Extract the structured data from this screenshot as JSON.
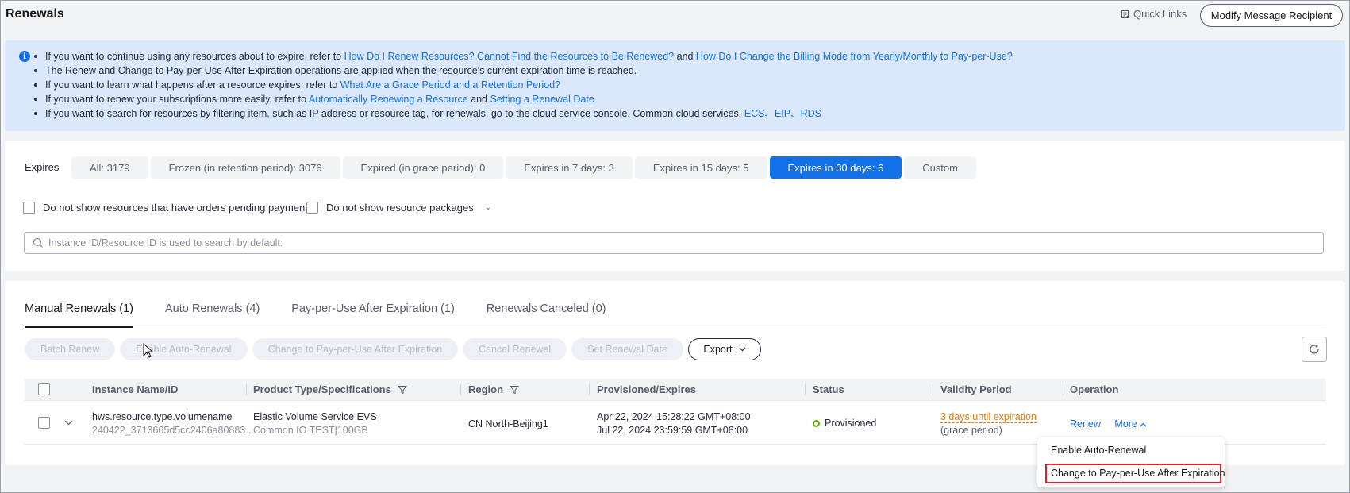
{
  "header": {
    "title": "Renewals",
    "quick_links": "Quick Links",
    "modify_button": "Modify Message Recipient"
  },
  "info": {
    "line1_a": "If you want to continue using any resources about to expire, refer to ",
    "line1_link1": "How Do I Renew Resources? Cannot Find the Resources to Be Renewed?",
    "line1_b": " and ",
    "line1_link2": "How Do I Change the Billing Mode from Yearly/Monthly to Pay-per-Use?",
    "line2": "The Renew and Change to Pay-per-Use After Expiration operations are applied when the resource's current expiration time is reached.",
    "line3_a": "If you want to learn what happens after a resource expires, refer to ",
    "line3_link": "What Are a Grace Period and a Retention Period?",
    "line4_a": "If you want to renew your subscriptions more easily, refer to ",
    "line4_link1": "Automatically Renewing a Resource",
    "line4_b": " and ",
    "line4_link2": "Setting a Renewal Date",
    "line5_a": "If you want to search for resources by filtering item, such as IP address or resource tag, for renewals, go to the cloud service console. Common cloud services: ",
    "line5_link1": "ECS",
    "line5_sep1": "、",
    "line5_link2": "EIP",
    "line5_sep2": "、",
    "line5_link3": "RDS"
  },
  "filters": {
    "expires_label": "Expires",
    "tabs": [
      "All: 3179",
      "Frozen (in retention period): 3076",
      "Expired (in grace period): 0",
      "Expires in 7 days: 3",
      "Expires in 15 days: 5",
      "Expires in 30 days: 6",
      "Custom"
    ],
    "active_tab": "Expires in 30 days: 6",
    "checkbox1": "Do not show resources that have orders pending payment",
    "checkbox2": "Do not show resource packages",
    "search_placeholder": "Instance ID/Resource ID is used to search by default."
  },
  "table_tabs": [
    "Manual Renewals (1)",
    "Auto Renewals (4)",
    "Pay-per-Use After Expiration (1)",
    "Renewals Canceled (0)"
  ],
  "actions": {
    "batch_renew": "Batch Renew",
    "enable_auto": "Enable Auto-Renewal",
    "change_ppu": "Change to Pay-per-Use After Expiration",
    "cancel_renewal": "Cancel Renewal",
    "set_date": "Set Renewal Date",
    "export": "Export"
  },
  "columns": {
    "instance": "Instance Name/ID",
    "product": "Product Type/Specifications",
    "region": "Region",
    "provisioned": "Provisioned/Expires",
    "status": "Status",
    "validity": "Validity Period",
    "operation": "Operation"
  },
  "row": {
    "name": "hws.resource.type.volumename",
    "id": "240422_3713665d5cc2406a80883...",
    "product": "Elastic Volume Service EVS",
    "spec": "Common IO TEST|100GB",
    "region": "CN North-Beijing1",
    "provisioned": "Apr 22, 2024 15:28:22 GMT+08:00",
    "expires": "Jul 22, 2024 23:59:59 GMT+08:00",
    "status": "Provisioned",
    "validity": "3 days until expiration",
    "validity_note": "(grace period)",
    "renew": "Renew",
    "more": "More"
  },
  "dropdown": {
    "item1": "Enable Auto-Renewal",
    "item2": "Change to Pay-per-Use After Expiration"
  },
  "colors": {
    "accent": "#1470e6",
    "warning": "#e37d0f",
    "success": "#5cb300",
    "highlight": "#e0202b"
  }
}
